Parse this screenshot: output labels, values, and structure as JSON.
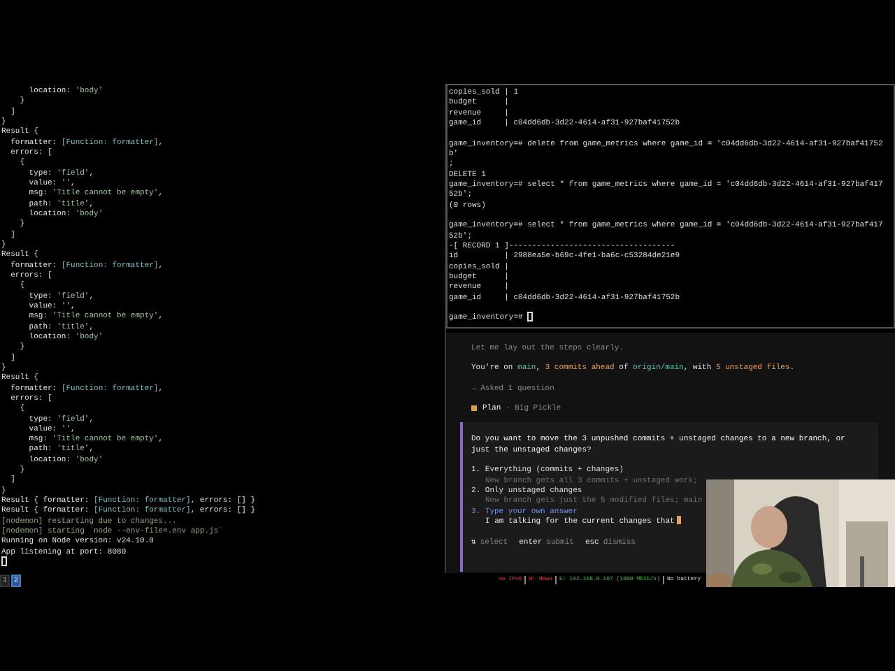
{
  "left_terminal": {
    "lines": [
      [
        {
          "text": "      location: ",
          "kind": "plain"
        },
        {
          "text": "'body'",
          "kind": "string"
        }
      ],
      "    }",
      "  ]",
      "}",
      "Result {",
      [
        {
          "text": "  formatter: ",
          "kind": "plain"
        },
        {
          "text": "[Function: formatter]",
          "kind": "function"
        },
        {
          "text": ",",
          "kind": "plain"
        }
      ],
      "  errors: [",
      "    {",
      [
        {
          "text": "      type: ",
          "kind": "plain"
        },
        {
          "text": "'field'",
          "kind": "string"
        },
        {
          "text": ",",
          "kind": "plain"
        }
      ],
      [
        {
          "text": "      value: ",
          "kind": "plain"
        },
        {
          "text": "''",
          "kind": "string"
        },
        {
          "text": ",",
          "kind": "plain"
        }
      ],
      [
        {
          "text": "      msg: ",
          "kind": "plain"
        },
        {
          "text": "'Title cannot be empty'",
          "kind": "string"
        },
        {
          "text": ",",
          "kind": "plain"
        }
      ],
      [
        {
          "text": "      path: ",
          "kind": "plain"
        },
        {
          "text": "'title'",
          "kind": "string"
        },
        {
          "text": ",",
          "kind": "plain"
        }
      ],
      [
        {
          "text": "      location: ",
          "kind": "plain"
        },
        {
          "text": "'body'",
          "kind": "string"
        }
      ],
      "    }",
      "  ]",
      "}",
      "Result {",
      [
        {
          "text": "  formatter: ",
          "kind": "plain"
        },
        {
          "text": "[Function: formatter]",
          "kind": "function"
        },
        {
          "text": ",",
          "kind": "plain"
        }
      ],
      "  errors: [",
      "    {",
      [
        {
          "text": "      type: ",
          "kind": "plain"
        },
        {
          "text": "'field'",
          "kind": "string"
        },
        {
          "text": ",",
          "kind": "plain"
        }
      ],
      [
        {
          "text": "      value: ",
          "kind": "plain"
        },
        {
          "text": "''",
          "kind": "string"
        },
        {
          "text": ",",
          "kind": "plain"
        }
      ],
      [
        {
          "text": "      msg: ",
          "kind": "plain"
        },
        {
          "text": "'Title cannot be empty'",
          "kind": "string"
        },
        {
          "text": ",",
          "kind": "plain"
        }
      ],
      [
        {
          "text": "      path: ",
          "kind": "plain"
        },
        {
          "text": "'title'",
          "kind": "string"
        },
        {
          "text": ",",
          "kind": "plain"
        }
      ],
      [
        {
          "text": "      location: ",
          "kind": "plain"
        },
        {
          "text": "'body'",
          "kind": "string"
        }
      ],
      "    }",
      "  ]",
      "}",
      "Result {",
      [
        {
          "text": "  formatter: ",
          "kind": "plain"
        },
        {
          "text": "[Function: formatter]",
          "kind": "function"
        },
        {
          "text": ",",
          "kind": "plain"
        }
      ],
      "  errors: [",
      "    {",
      [
        {
          "text": "      type: ",
          "kind": "plain"
        },
        {
          "text": "'field'",
          "kind": "string"
        },
        {
          "text": ",",
          "kind": "plain"
        }
      ],
      [
        {
          "text": "      value: ",
          "kind": "plain"
        },
        {
          "text": "''",
          "kind": "string"
        },
        {
          "text": ",",
          "kind": "plain"
        }
      ],
      [
        {
          "text": "      msg: ",
          "kind": "plain"
        },
        {
          "text": "'Title cannot be empty'",
          "kind": "string"
        },
        {
          "text": ",",
          "kind": "plain"
        }
      ],
      [
        {
          "text": "      path: ",
          "kind": "plain"
        },
        {
          "text": "'title'",
          "kind": "string"
        },
        {
          "text": ",",
          "kind": "plain"
        }
      ],
      [
        {
          "text": "      location: ",
          "kind": "plain"
        },
        {
          "text": "'body'",
          "kind": "string"
        }
      ],
      "    }",
      "  ]",
      "}",
      [
        {
          "text": "Result { formatter: ",
          "kind": "plain"
        },
        {
          "text": "[Function: formatter]",
          "kind": "function"
        },
        {
          "text": ", errors: [] }",
          "kind": "plain"
        }
      ],
      [
        {
          "text": "Result { formatter: ",
          "kind": "plain"
        },
        {
          "text": "[Function: formatter]",
          "kind": "function"
        },
        {
          "text": ", errors: [] }",
          "kind": "plain"
        }
      ],
      [
        {
          "text": "[nodemon] restarting due to changes...",
          "kind": "dim"
        }
      ],
      [
        {
          "text": "[nodemon] starting `node --env-file=.env app.js`",
          "kind": "dim"
        }
      ],
      "Running on Node version: v24.10.0",
      "App listening at port: 8080"
    ]
  },
  "psql_terminal": {
    "blocks": [
      [
        "copies_sold | 1",
        "budget      |",
        "revenue     |",
        "game_id     | c04dd6db-3d22-4614-af31-927baf41752b"
      ],
      [
        "game_inventory=# delete from game_metrics where game_id = 'c04dd6db-3d22-4614-af31-927baf41752",
        "b'",
        ";",
        "DELETE 1",
        "game_inventory=# select * from game_metrics where game_id = 'c04dd6db-3d22-4614-af31-927baf417",
        "52b';",
        "(0 rows)"
      ],
      [
        "game_inventory=# select * from game_metrics where game_id = 'c04dd6db-3d22-4614-af31-927baf417",
        "52b';",
        "-[ RECORD 1 ]------------------------------------",
        "id          | 2988ea5e-b69c-4fe1-ba6c-c53284de21e9",
        "copies_sold |",
        "budget      |",
        "revenue     |",
        "game_id     | c04dd6db-3d22-4614-af31-927baf41752b"
      ]
    ],
    "prompt": "game_inventory=# "
  },
  "assistant_pane": {
    "intro": "Let me lay out the steps clearly.",
    "status": [
      {
        "text": "You're on ",
        "kind": "plain"
      },
      {
        "text": "main",
        "kind": "teal"
      },
      {
        "text": ", ",
        "kind": "plain"
      },
      {
        "text": "3 commits ahead",
        "kind": "orange"
      },
      {
        "text": " of ",
        "kind": "plain"
      },
      {
        "text": "origin/main",
        "kind": "teal"
      },
      {
        "text": ", with ",
        "kind": "plain"
      },
      {
        "text": "5 unstaged files",
        "kind": "orange"
      },
      {
        "text": ".",
        "kind": "plain"
      }
    ],
    "tool_note": "→ Asked 1 question",
    "agent": {
      "mode": "Plan",
      "model": "· Big Pickle"
    },
    "question": {
      "text": "Do you want to move the 3 unpushed commits + unstaged changes to a new branch, or just the unstaged changes?",
      "options": [
        {
          "kind": "choice",
          "number": "1.",
          "label": "Everything (commits + changes)",
          "description": "New branch gets all 3 commits + unstaged work;",
          "selected": false
        },
        {
          "kind": "choice",
          "number": "2.",
          "label": "Only unstaged changes",
          "description": "New branch gets just the 5 modified files; main",
          "selected": false
        },
        {
          "kind": "custom",
          "number": "3.",
          "label": "Type your own answer",
          "value": "I am talking for the current changes that",
          "selected": true
        }
      ],
      "hints": [
        {
          "key": "⇅",
          "action": "select"
        },
        {
          "key": "enter",
          "action": "submit"
        },
        {
          "key": "esc",
          "action": "dismiss"
        }
      ]
    }
  },
  "status_bar": {
    "workspaces": [
      {
        "label": "1",
        "selected": false
      },
      {
        "label": "2",
        "selected": true
      }
    ],
    "items": [
      {
        "text": "no IPv6",
        "kind": "bad"
      },
      {
        "text": "W: down",
        "kind": "bad"
      },
      {
        "text": "E: 192.168.0.107 (1000 Mbit/s)",
        "kind": "good"
      },
      {
        "text": "No battery",
        "kind": "neutral"
      }
    ]
  }
}
